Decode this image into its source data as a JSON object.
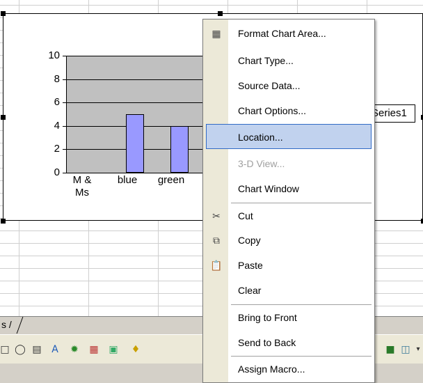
{
  "chart_data": {
    "type": "bar",
    "categories": [
      "M & Ms",
      "blue",
      "green"
    ],
    "series": [
      {
        "name": "Series1",
        "values": [
          0,
          5,
          4
        ]
      }
    ],
    "yticks": [
      "0",
      "2",
      "4",
      "6",
      "8",
      "10"
    ],
    "ylim": [
      0,
      10
    ],
    "legend": "right",
    "grid": true,
    "bar_color": "#9999ff",
    "plot_bg": "#c0c0c0"
  },
  "chart": {
    "xlabels": [
      "M &",
      "Ms",
      "blue",
      "green"
    ],
    "legend_label": "Series1"
  },
  "sheet": {
    "tab_label": "s /"
  },
  "context_menu": {
    "items": [
      {
        "label": "Format Chart Area...",
        "icon": "format-chart-area-icon"
      },
      {
        "label": "Chart Type..."
      },
      {
        "label": "Source Data..."
      },
      {
        "label": "Chart Options..."
      },
      {
        "label": "Location...",
        "highlighted": true
      },
      {
        "label": "3-D View...",
        "disabled": true
      },
      {
        "label": "Chart Window"
      },
      {
        "label": "Cut",
        "icon": "scissors-icon"
      },
      {
        "label": "Copy",
        "icon": "copy-icon"
      },
      {
        "label": "Paste",
        "icon": "paste-icon"
      },
      {
        "label": "Clear"
      },
      {
        "label": "Bring to Front"
      },
      {
        "label": "Send to Back"
      },
      {
        "label": "Assign Macro..."
      }
    ]
  },
  "colors": {
    "highlight_bg": "#c1d2ee",
    "highlight_border": "#316ac5"
  }
}
